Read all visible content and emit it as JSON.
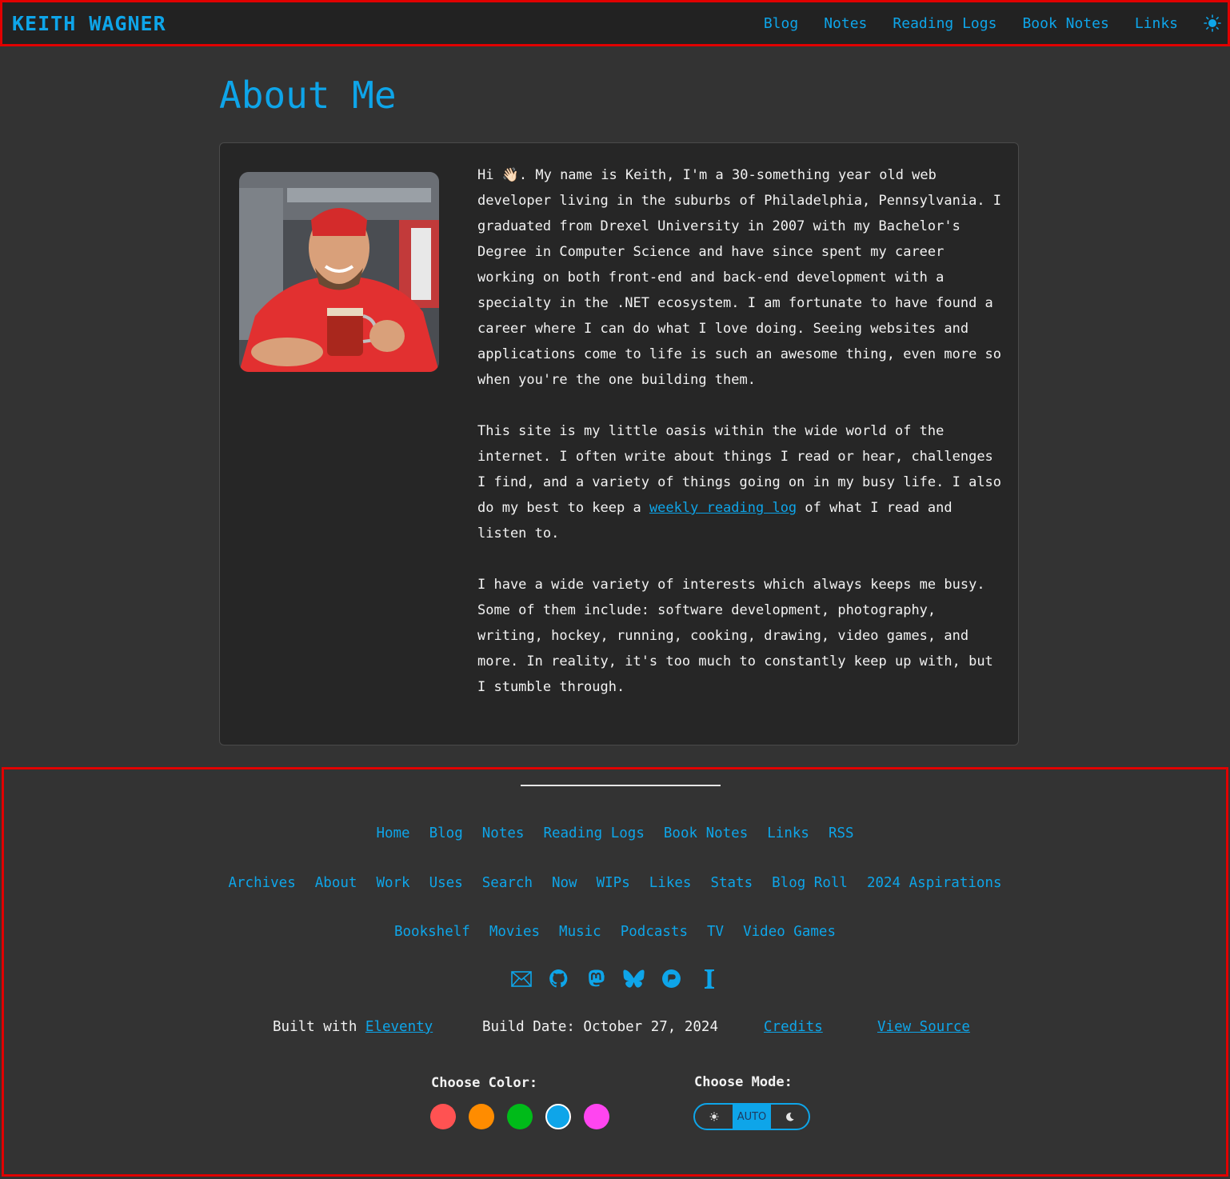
{
  "header": {
    "brand": "KEITH WAGNER",
    "nav": [
      "Blog",
      "Notes",
      "Reading Logs",
      "Book Notes",
      "Links"
    ],
    "theme_icon": "sun-icon"
  },
  "page": {
    "title": "About Me",
    "photo_alt": "Keith smiling holding a beer mug",
    "paragraphs": {
      "p1_before_emoji": "Hi ",
      "emoji": "👋🏻",
      "p1_after_emoji": ". My name is Keith, I'm a 30-something year old web developer living in the suburbs of Philadelphia, Pennsylvania. I graduated from Drexel University in 2007 with my Bachelor's Degree in Computer Science and have since spent my career working on both front-end and back-end development with a specialty in the .NET ecosystem. I am fortunate to have found a career where I can do what I love doing. Seeing websites and applications come to life is such an awesome thing, even more so when you're the one building them.",
      "p2_before_link": "This site is my little oasis within the wide world of the internet. I often write about things I read or hear, challenges I find, and a variety of things going on in my busy life. I also do my best to keep a ",
      "p2_link": "weekly reading log",
      "p2_after_link": " of what I read and listen to.",
      "p3": "I have a wide variety of interests which always keeps me busy. Some of them include: software development, photography, writing, hockey, running, cooking, drawing, video games, and more. In reality, it's too much to constantly keep up with, but I stumble through."
    }
  },
  "footer": {
    "row1": [
      "Home",
      "Blog",
      "Notes",
      "Reading Logs",
      "Book Notes",
      "Links",
      "RSS"
    ],
    "row2": [
      "Archives",
      "About",
      "Work",
      "Uses",
      "Search",
      "Now",
      "WIPs",
      "Likes",
      "Stats",
      "Blog Roll",
      "2024 Aspirations"
    ],
    "row3": [
      "Bookshelf",
      "Movies",
      "Music",
      "Podcasts",
      "TV",
      "Video Games"
    ],
    "socials": [
      "email-icon",
      "github-icon",
      "mastodon-icon",
      "bluesky-icon",
      "micro-blog-icon",
      "instapaper-icon"
    ],
    "built_with_label": "Built with ",
    "built_with_link": "Eleventy",
    "build_date": "Build Date: October 27, 2024",
    "credits": "Credits",
    "view_source": "View Source",
    "choose_color_label": "Choose Color:",
    "colors": [
      "#ff5252",
      "#ff8c00",
      "#00bb19",
      "#0ea5e9",
      "#ff45f0"
    ],
    "selected_color": "#0ea5e9",
    "choose_mode_label": "Choose Mode:",
    "modes": [
      "light",
      "AUTO",
      "dark"
    ],
    "selected_mode": "AUTO"
  },
  "colors": {
    "accent": "#0ea5e9",
    "background": "#333333",
    "card": "#262626",
    "header": "#222222"
  }
}
